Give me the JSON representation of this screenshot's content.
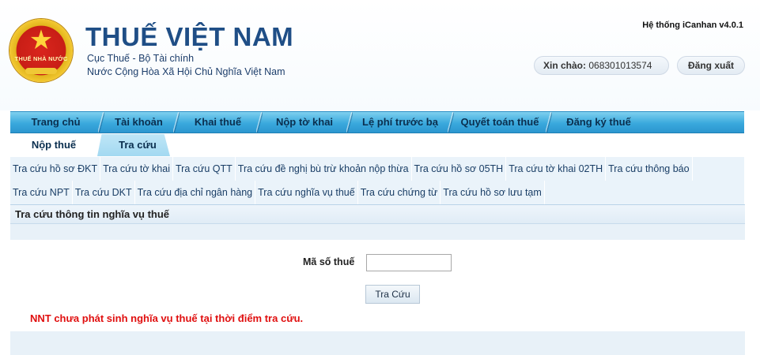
{
  "header": {
    "logo_text": "THUẾ NHÀ NƯỚC",
    "title": "THUẾ VIỆT NAM",
    "subtitle_1": "Cục Thuế - Bộ Tài chính",
    "subtitle_2": "Nước Cộng Hòa Xã Hội Chủ Nghĩa Việt Nam",
    "system_version": "Hệ thống iCanhan v4.0.1",
    "greeting_label": "Xin chào:",
    "user_id": "068301013574",
    "logout_label": "Đăng xuất"
  },
  "main_nav": {
    "items": [
      {
        "label": "Trang chủ"
      },
      {
        "label": "Tài khoản"
      },
      {
        "label": "Khai thuế"
      },
      {
        "label": "Nộp tờ khai"
      },
      {
        "label": "Lệ phí trước bạ"
      },
      {
        "label": "Quyết toán thuế"
      },
      {
        "label": "Đăng ký thuế"
      }
    ]
  },
  "sub_tabs": {
    "items": [
      {
        "label": "Nộp thuế"
      },
      {
        "label": "Tra cứu"
      }
    ]
  },
  "links": {
    "row1": [
      {
        "label": "Tra cứu hồ sơ ĐKT"
      },
      {
        "label": "Tra cứu tờ khai"
      },
      {
        "label": "Tra cứu QTT"
      },
      {
        "label": "Tra cứu đề nghị bù trừ khoản nộp thừa"
      },
      {
        "label": "Tra cứu hồ sơ 05TH"
      },
      {
        "label": "Tra cứu tờ khai 02TH"
      },
      {
        "label": "Tra cứu thông báo"
      }
    ],
    "row2": [
      {
        "label": "Tra cứu NPT"
      },
      {
        "label": "Tra cứu DKT"
      },
      {
        "label": "Tra cứu địa chỉ ngân hàng"
      },
      {
        "label": "Tra cứu nghĩa vụ thuế"
      },
      {
        "label": "Tra cứu chứng từ"
      },
      {
        "label": "Tra cứu hồ sơ lưu tạm"
      }
    ]
  },
  "panel": {
    "title": "Tra cứu thông tin nghĩa vụ thuế",
    "tax_code_label": "Mã số thuế",
    "tax_code_value": "",
    "search_button": "Tra Cứu",
    "message": "NNT chưa phát sinh nghĩa vụ thuế tại thời điểm tra cứu."
  },
  "colors": {
    "brand_blue": "#1f4e86",
    "nav_blue": "#3aa9dd",
    "error_red": "#e00f0f"
  }
}
